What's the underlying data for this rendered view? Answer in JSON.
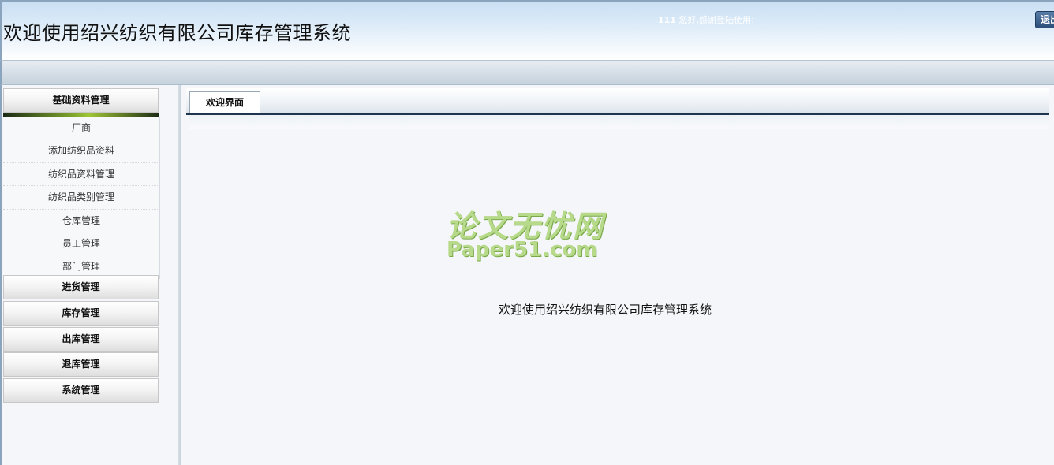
{
  "header": {
    "title": "欢迎使用绍兴纺织有限公司库存管理系统",
    "greeting_user": "111",
    "greeting_text": " 您好,感谢登陆使用!",
    "logout_label": "退出"
  },
  "sidebar": {
    "groups": [
      {
        "label": "基础资料管理",
        "items": [
          "厂商",
          "添加纺织品资料",
          "纺织品资料管理",
          "纺织品类别管理",
          "仓库管理",
          "员工管理",
          "部门管理"
        ]
      },
      {
        "label": "进货管理"
      },
      {
        "label": "库存管理"
      },
      {
        "label": "出库管理"
      },
      {
        "label": "退库管理"
      },
      {
        "label": "系统管理"
      }
    ]
  },
  "main": {
    "tabs": [
      {
        "label": "欢迎界面"
      }
    ],
    "watermark_cn": "论文无忧网",
    "watermark_en": "Paper51.com",
    "welcome_text": "欢迎使用绍兴纺织有限公司库存管理系统"
  },
  "colors": {
    "header_top": "#c9dff3",
    "tab_underline": "#1f3550",
    "accent_green": "#9fc536"
  }
}
